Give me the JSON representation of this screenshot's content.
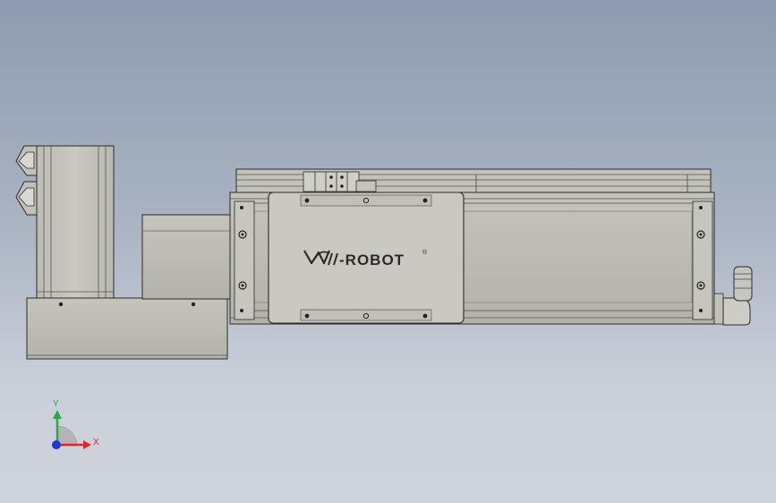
{
  "model": {
    "brand_text": "-ROBOT",
    "registered_mark": "®"
  },
  "triad": {
    "x_label": "X",
    "y_label": "Y",
    "x_color": "#e0262a",
    "y_color": "#2aa845",
    "z_color": "#2235d8"
  }
}
